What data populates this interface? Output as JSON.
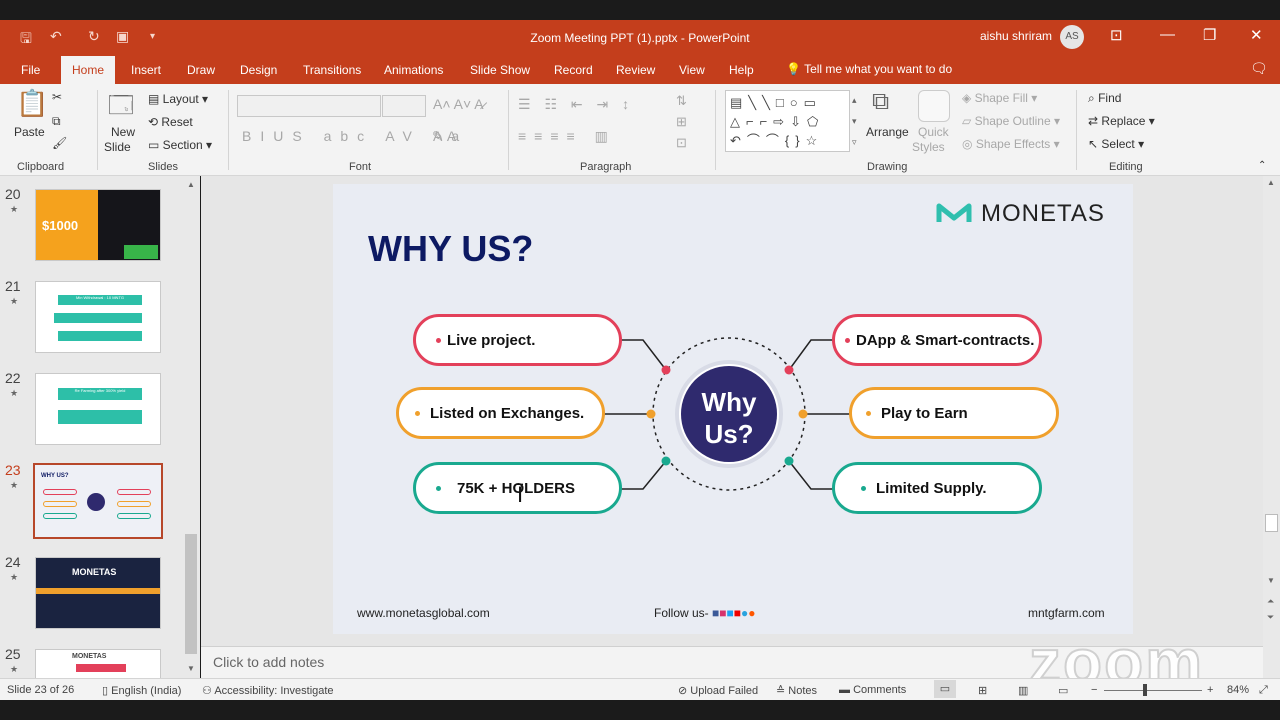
{
  "app": {
    "title": "Zoom Meeting PPT (1).pptx  -  PowerPoint",
    "user_name": "aishu shriram",
    "user_initials": "AS"
  },
  "menu": {
    "tabs": [
      "File",
      "Home",
      "Insert",
      "Draw",
      "Design",
      "Transitions",
      "Animations",
      "Slide Show",
      "Record",
      "Review",
      "View",
      "Help"
    ],
    "active": "Home",
    "tell_me": "Tell me what you want to do"
  },
  "ribbon": {
    "paste": "Paste",
    "clipboard": "Clipboard",
    "new_slide": "New",
    "new_slide2": "Slide",
    "layout": "Layout",
    "reset": "Reset",
    "section": "Section",
    "slides": "Slides",
    "font": "Font",
    "paragraph": "Paragraph",
    "arrange": "Arrange",
    "quick_styles": "Quick",
    "quick_styles2": "Styles",
    "shape_fill": "Shape Fill",
    "shape_outline": "Shape Outline",
    "shape_effects": "Shape Effects",
    "drawing": "Drawing",
    "find": "Find",
    "replace": "Replace",
    "select": "Select",
    "editing": "Editing"
  },
  "thumbnails": [
    {
      "num": "20",
      "text": "$1000"
    },
    {
      "num": "21",
      "text": "Min Withdrawal : 10 MNTG"
    },
    {
      "num": "22",
      "text": "Re Farming after 300% yield"
    },
    {
      "num": "23",
      "text": "WHY US?",
      "selected": true
    },
    {
      "num": "24",
      "text": "MONETAS"
    },
    {
      "num": "25",
      "text": "MONETAS"
    }
  ],
  "slide": {
    "logo": "MONETAS",
    "title": "WHY US?",
    "center_line1": "Why",
    "center_line2": "Us?",
    "left_items": [
      "Live project.",
      "Listed on Exchanges.",
      "75K + HOLDERS"
    ],
    "right_items": [
      "DApp & Smart-contracts.",
      "Play to Earn",
      "Limited Supply."
    ],
    "footer_left": "www.monetasglobal.com",
    "footer_mid": "Follow us-",
    "footer_right": "mntgfarm.com"
  },
  "notes_placeholder": "Click to add notes",
  "status": {
    "slide": "Slide 23 of 26",
    "language": "English (India)",
    "accessibility": "Accessibility: Investigate",
    "upload": "Upload Failed",
    "notes": "Notes",
    "comments": "Comments",
    "zoom": "84%"
  },
  "watermark": "zoom",
  "colors": {
    "accent": "#c43e1c",
    "navy": "#0d1a63",
    "red": "#e3405a",
    "orange": "#f0a02c",
    "teal": "#19a98f",
    "center": "#2f2a6e"
  }
}
